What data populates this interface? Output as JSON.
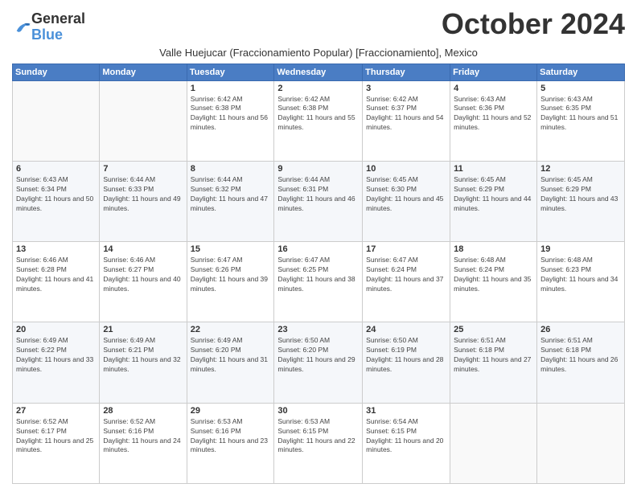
{
  "logo": {
    "general": "General",
    "blue": "Blue"
  },
  "header": {
    "month_title": "October 2024",
    "subtitle": "Valle Huejucar (Fraccionamiento Popular) [Fraccionamiento], Mexico"
  },
  "days_of_week": [
    "Sunday",
    "Monday",
    "Tuesday",
    "Wednesday",
    "Thursday",
    "Friday",
    "Saturday"
  ],
  "weeks": [
    [
      {
        "day": "",
        "info": ""
      },
      {
        "day": "",
        "info": ""
      },
      {
        "day": "1",
        "info": "Sunrise: 6:42 AM\nSunset: 6:38 PM\nDaylight: 11 hours and 56 minutes."
      },
      {
        "day": "2",
        "info": "Sunrise: 6:42 AM\nSunset: 6:38 PM\nDaylight: 11 hours and 55 minutes."
      },
      {
        "day": "3",
        "info": "Sunrise: 6:42 AM\nSunset: 6:37 PM\nDaylight: 11 hours and 54 minutes."
      },
      {
        "day": "4",
        "info": "Sunrise: 6:43 AM\nSunset: 6:36 PM\nDaylight: 11 hours and 52 minutes."
      },
      {
        "day": "5",
        "info": "Sunrise: 6:43 AM\nSunset: 6:35 PM\nDaylight: 11 hours and 51 minutes."
      }
    ],
    [
      {
        "day": "6",
        "info": "Sunrise: 6:43 AM\nSunset: 6:34 PM\nDaylight: 11 hours and 50 minutes."
      },
      {
        "day": "7",
        "info": "Sunrise: 6:44 AM\nSunset: 6:33 PM\nDaylight: 11 hours and 49 minutes."
      },
      {
        "day": "8",
        "info": "Sunrise: 6:44 AM\nSunset: 6:32 PM\nDaylight: 11 hours and 47 minutes."
      },
      {
        "day": "9",
        "info": "Sunrise: 6:44 AM\nSunset: 6:31 PM\nDaylight: 11 hours and 46 minutes."
      },
      {
        "day": "10",
        "info": "Sunrise: 6:45 AM\nSunset: 6:30 PM\nDaylight: 11 hours and 45 minutes."
      },
      {
        "day": "11",
        "info": "Sunrise: 6:45 AM\nSunset: 6:29 PM\nDaylight: 11 hours and 44 minutes."
      },
      {
        "day": "12",
        "info": "Sunrise: 6:45 AM\nSunset: 6:29 PM\nDaylight: 11 hours and 43 minutes."
      }
    ],
    [
      {
        "day": "13",
        "info": "Sunrise: 6:46 AM\nSunset: 6:28 PM\nDaylight: 11 hours and 41 minutes."
      },
      {
        "day": "14",
        "info": "Sunrise: 6:46 AM\nSunset: 6:27 PM\nDaylight: 11 hours and 40 minutes."
      },
      {
        "day": "15",
        "info": "Sunrise: 6:47 AM\nSunset: 6:26 PM\nDaylight: 11 hours and 39 minutes."
      },
      {
        "day": "16",
        "info": "Sunrise: 6:47 AM\nSunset: 6:25 PM\nDaylight: 11 hours and 38 minutes."
      },
      {
        "day": "17",
        "info": "Sunrise: 6:47 AM\nSunset: 6:24 PM\nDaylight: 11 hours and 37 minutes."
      },
      {
        "day": "18",
        "info": "Sunrise: 6:48 AM\nSunset: 6:24 PM\nDaylight: 11 hours and 35 minutes."
      },
      {
        "day": "19",
        "info": "Sunrise: 6:48 AM\nSunset: 6:23 PM\nDaylight: 11 hours and 34 minutes."
      }
    ],
    [
      {
        "day": "20",
        "info": "Sunrise: 6:49 AM\nSunset: 6:22 PM\nDaylight: 11 hours and 33 minutes."
      },
      {
        "day": "21",
        "info": "Sunrise: 6:49 AM\nSunset: 6:21 PM\nDaylight: 11 hours and 32 minutes."
      },
      {
        "day": "22",
        "info": "Sunrise: 6:49 AM\nSunset: 6:20 PM\nDaylight: 11 hours and 31 minutes."
      },
      {
        "day": "23",
        "info": "Sunrise: 6:50 AM\nSunset: 6:20 PM\nDaylight: 11 hours and 29 minutes."
      },
      {
        "day": "24",
        "info": "Sunrise: 6:50 AM\nSunset: 6:19 PM\nDaylight: 11 hours and 28 minutes."
      },
      {
        "day": "25",
        "info": "Sunrise: 6:51 AM\nSunset: 6:18 PM\nDaylight: 11 hours and 27 minutes."
      },
      {
        "day": "26",
        "info": "Sunrise: 6:51 AM\nSunset: 6:18 PM\nDaylight: 11 hours and 26 minutes."
      }
    ],
    [
      {
        "day": "27",
        "info": "Sunrise: 6:52 AM\nSunset: 6:17 PM\nDaylight: 11 hours and 25 minutes."
      },
      {
        "day": "28",
        "info": "Sunrise: 6:52 AM\nSunset: 6:16 PM\nDaylight: 11 hours and 24 minutes."
      },
      {
        "day": "29",
        "info": "Sunrise: 6:53 AM\nSunset: 6:16 PM\nDaylight: 11 hours and 23 minutes."
      },
      {
        "day": "30",
        "info": "Sunrise: 6:53 AM\nSunset: 6:15 PM\nDaylight: 11 hours and 22 minutes."
      },
      {
        "day": "31",
        "info": "Sunrise: 6:54 AM\nSunset: 6:15 PM\nDaylight: 11 hours and 20 minutes."
      },
      {
        "day": "",
        "info": ""
      },
      {
        "day": "",
        "info": ""
      }
    ]
  ]
}
